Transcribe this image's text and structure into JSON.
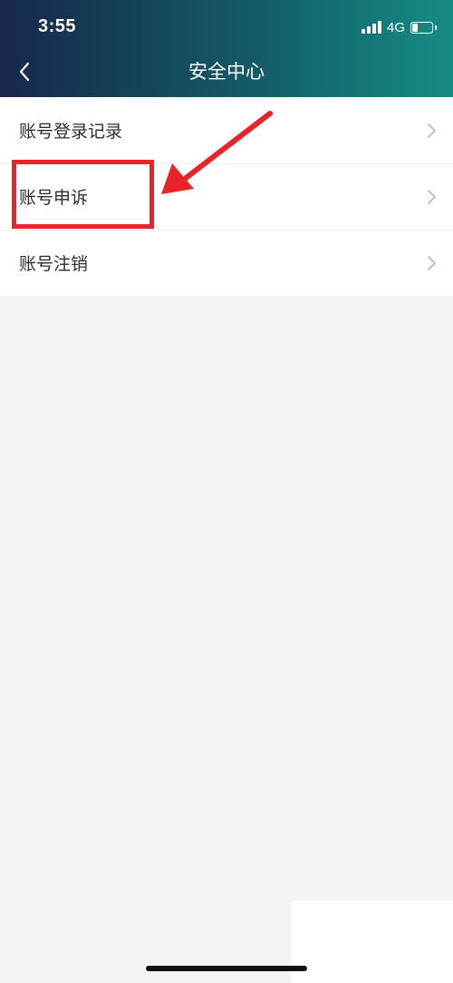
{
  "status_bar": {
    "time": "3:55",
    "network": "4G",
    "battery_level": 0.3
  },
  "header": {
    "back_icon": "chevron-left-icon",
    "title": "安全中心"
  },
  "menu": {
    "items": [
      {
        "label": "账号登录记录",
        "icon": "chevron-right-icon"
      },
      {
        "label": "账号申诉",
        "icon": "chevron-right-icon"
      },
      {
        "label": "账号注销",
        "icon": "chevron-right-icon"
      }
    ]
  },
  "annotation": {
    "highlight_color": "#e8232a",
    "highlighted_item": "账号申诉"
  }
}
